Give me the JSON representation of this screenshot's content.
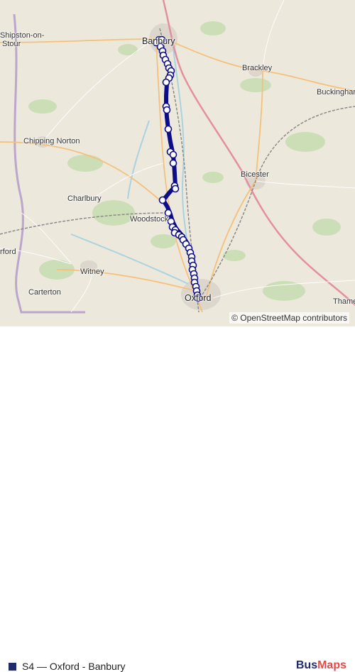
{
  "map": {
    "places": [
      {
        "key": "banbury",
        "label": "Banbury"
      },
      {
        "key": "brackley",
        "label": "Brackley"
      },
      {
        "key": "buckingham",
        "label": "Buckinghar"
      },
      {
        "key": "shipston_1",
        "label": "Shipston-on-"
      },
      {
        "key": "shipston_2",
        "label": "Stour"
      },
      {
        "key": "chipping_norton",
        "label": "Chipping Norton"
      },
      {
        "key": "bicester",
        "label": "Bicester"
      },
      {
        "key": "charlbury",
        "label": "Charlbury"
      },
      {
        "key": "woodstock",
        "label": "Woodstock"
      },
      {
        "key": "witney",
        "label": "Witney"
      },
      {
        "key": "carterton",
        "label": "Carterton"
      },
      {
        "key": "oxford",
        "label": "Oxford"
      },
      {
        "key": "thame",
        "label": "Thame"
      },
      {
        "key": "burford",
        "label": "rford"
      }
    ],
    "attribution": "© OpenStreetMap contributors",
    "colors": {
      "route": "#0d0d8a",
      "stop_fill": "#ffffff",
      "land": "#ece8dc",
      "forest": "#c7dcb0",
      "water": "#aad3df"
    }
  },
  "legend": {
    "swatch_color": "#1f2b6b",
    "label": "S4 — Oxford - Banbury"
  },
  "brand": {
    "part1": "Bus",
    "part2": "Maps"
  }
}
